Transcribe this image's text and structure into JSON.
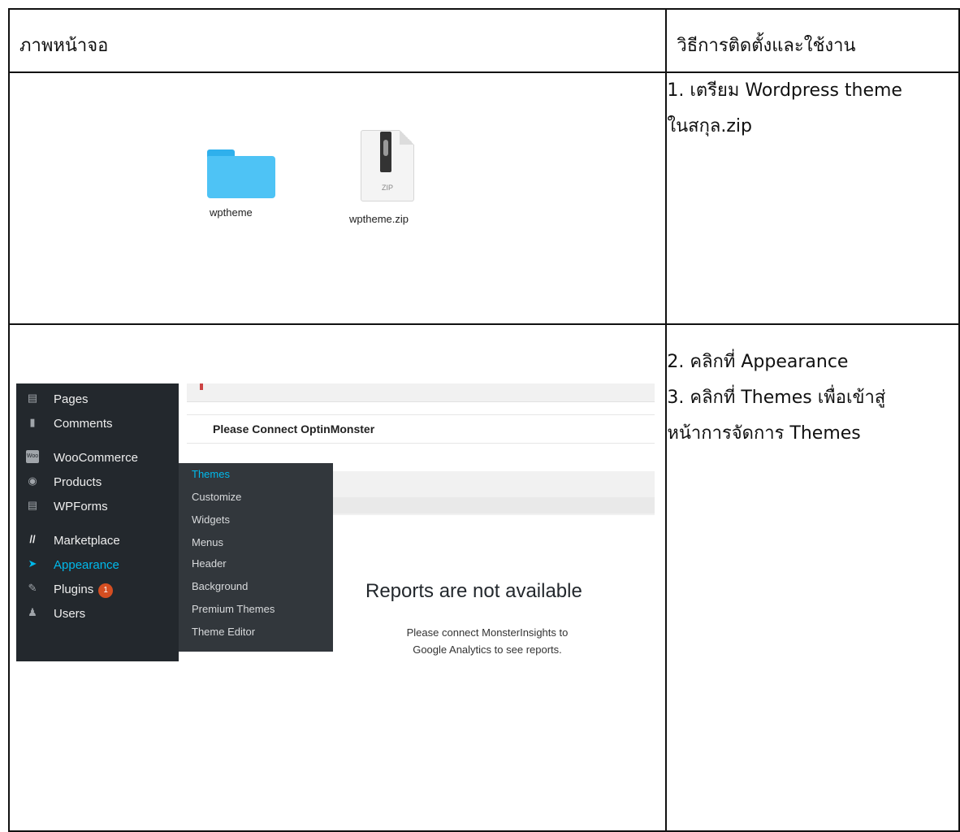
{
  "table": {
    "headers": [
      "ภาพหน้าจอ",
      "วิธีการติดตั้งและใช้งาน"
    ],
    "step1": [
      "1. เตรียม Wordpress theme",
      "ในสกุล.zip"
    ],
    "step2": [
      "2. คลิกที่ Appearance",
      "3. คลิกที่ Themes เพื่อเข้าสู่",
      "หน้าการจัดการ Themes"
    ]
  },
  "files": {
    "folder_label": "wptheme",
    "zip_label": "wptheme.zip",
    "zip_icon_text": "ZIP",
    "folder_color": "#4ec3f5"
  },
  "wp": {
    "sidebar": [
      {
        "label": "Pages",
        "icon": "pages-icon"
      },
      {
        "label": "Comments",
        "icon": "comments-icon"
      },
      {
        "label": "WooCommerce",
        "icon": "woocommerce-icon"
      },
      {
        "label": "Products",
        "icon": "products-icon"
      },
      {
        "label": "WPForms",
        "icon": "wpforms-icon"
      },
      {
        "label": "Marketplace",
        "icon": "marketplace-icon"
      },
      {
        "label": "Appearance",
        "icon": "appearance-icon",
        "active": true
      },
      {
        "label": "Plugins",
        "icon": "plugins-icon",
        "badge": "1"
      },
      {
        "label": "Users",
        "icon": "users-icon"
      }
    ],
    "woo_icon_text": "Woo",
    "flyout": [
      "Themes",
      "Customize",
      "Widgets",
      "Menus",
      "Header",
      "Background",
      "Premium Themes",
      "Theme Editor"
    ],
    "notice": "Please Connect OptinMonster",
    "reports_title": "Reports are not available",
    "reports_subtitle_line1": "Please connect MonsterInsights to",
    "reports_subtitle_line2": "Google Analytics to see reports.",
    "colors": {
      "sidebar": "#23282d",
      "flyout": "#32373c",
      "accent": "#00b9eb",
      "badge": "#d54e21"
    }
  }
}
